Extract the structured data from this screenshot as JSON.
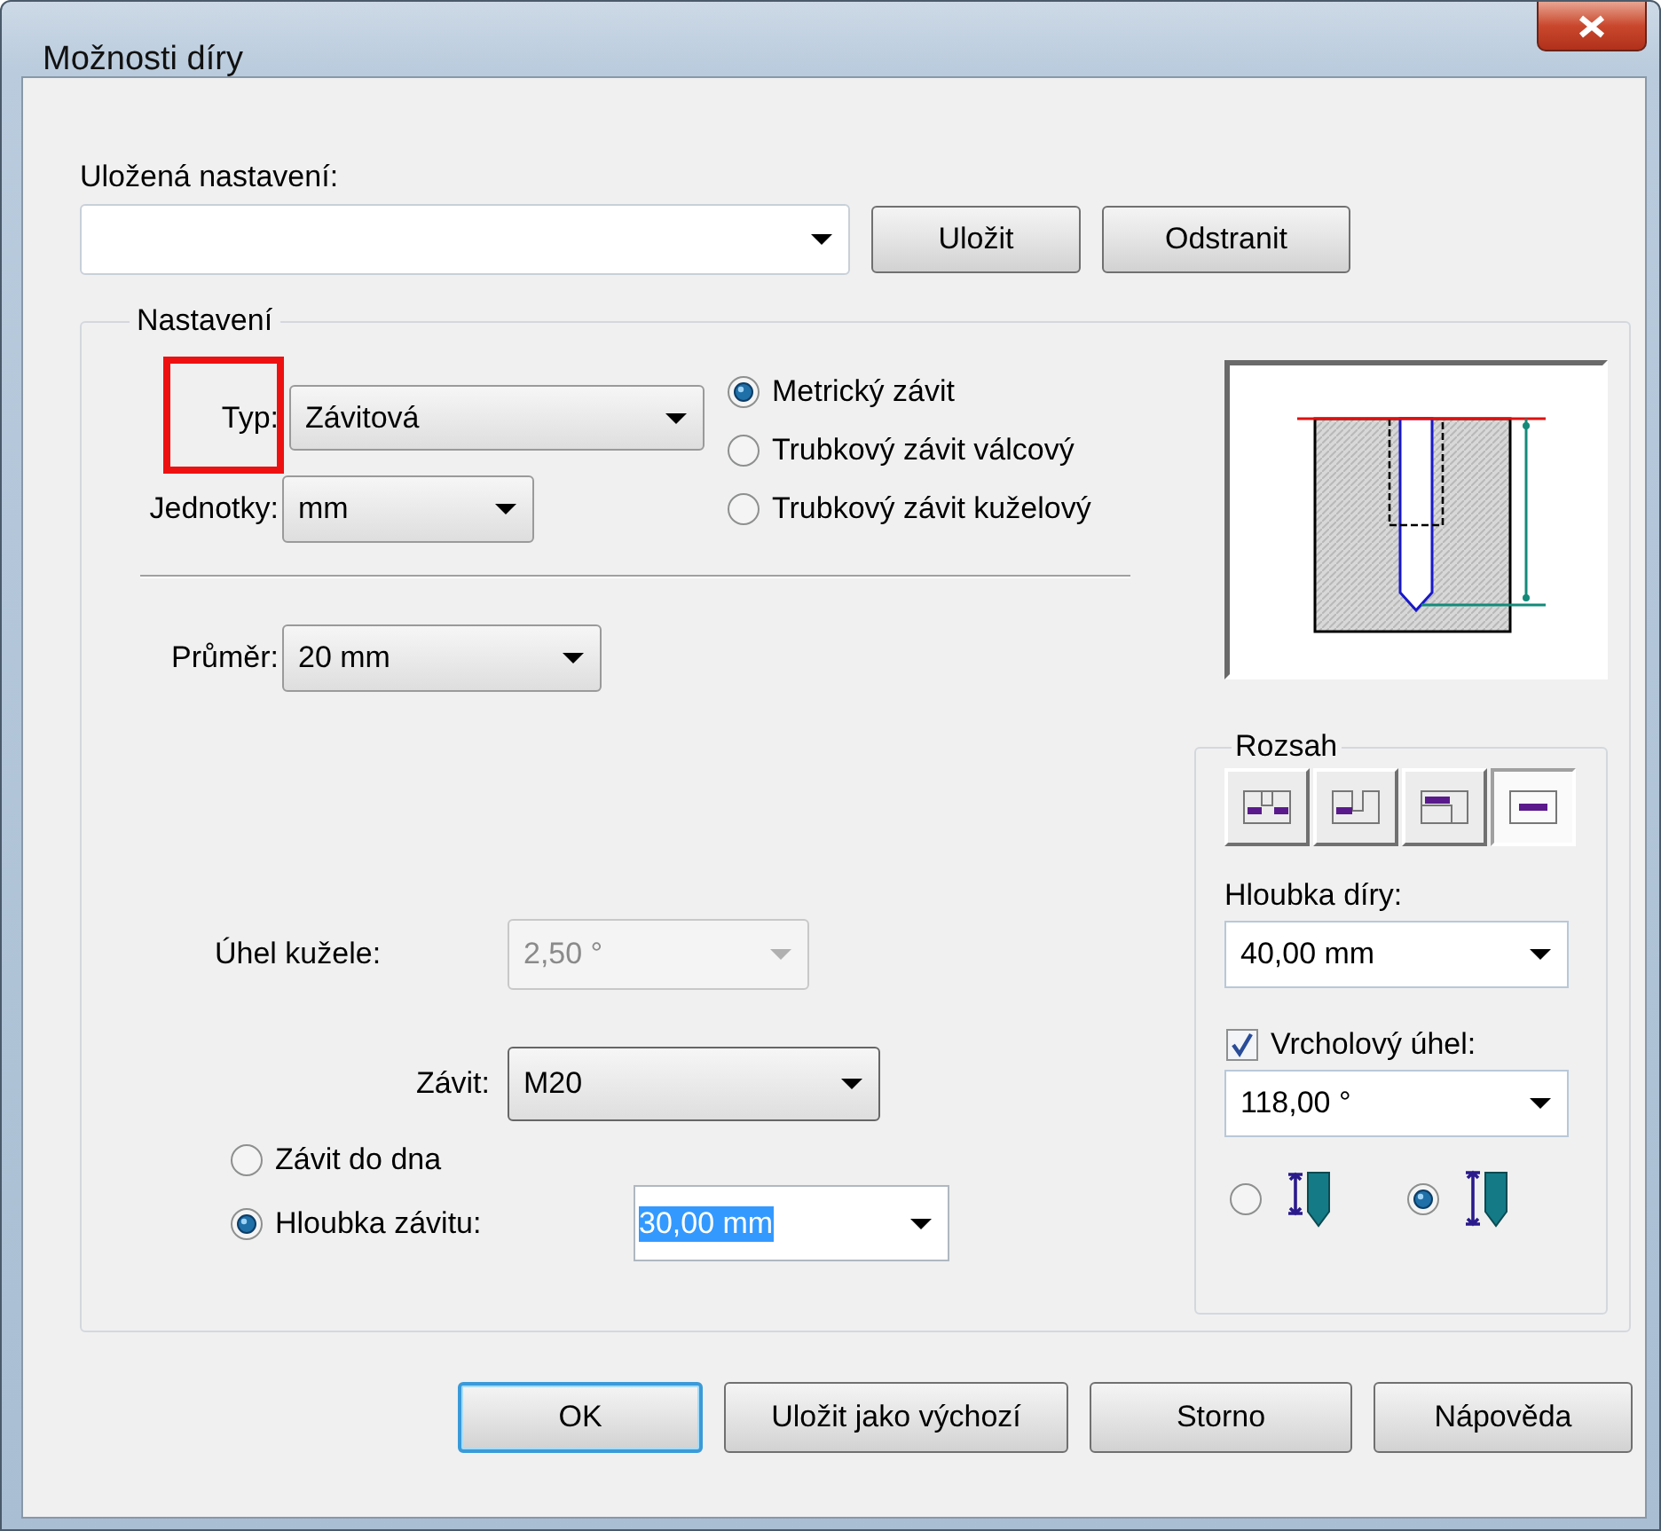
{
  "window": {
    "title": "Možnosti díry"
  },
  "saved_settings": {
    "label": "Uložená nastavení:",
    "buttons": [
      "Uložit",
      "Odstranit"
    ]
  },
  "settings": {
    "title": "Nastavení",
    "type": {
      "label": "Typ:",
      "value": "Závitová",
      "highlighted": true
    },
    "units": {
      "label": "Jednotky:",
      "value": "mm"
    },
    "thread_standards": [
      {
        "label": "Metrický závit",
        "selected": true
      },
      {
        "label": "Trubkový závit válcový",
        "selected": false
      },
      {
        "label": "Trubkový závit kuželový",
        "selected": false
      }
    ],
    "diameter": {
      "label": "Průměr:",
      "value": "20 mm"
    },
    "cone_angle": {
      "label": "Úhel kužele:",
      "value": "2,50 °",
      "disabled": true
    },
    "thread": {
      "label": "Závit:",
      "value": "M20"
    },
    "thread_extent": [
      {
        "label": "Závit do dna",
        "selected": false
      },
      {
        "label": "Hloubka závitu:",
        "selected": true
      }
    ],
    "thread_depth": {
      "value": "30,00 mm",
      "text_selected": true
    },
    "extent": {
      "title": "Rozsah",
      "options": [
        {
          "kind": "through",
          "selected": false
        },
        {
          "kind": "to-next",
          "selected": false
        },
        {
          "kind": "to-surface",
          "selected": false
        },
        {
          "kind": "distance",
          "selected": true
        }
      ],
      "hole_depth": {
        "label": "Hloubka díry:",
        "value": "40,00 mm"
      },
      "tip_angle": {
        "label": "Vrcholový úhel:",
        "checked": true,
        "value": "118,00 °"
      },
      "depth_reference": [
        {
          "kind": "to-shoulder",
          "selected": false
        },
        {
          "kind": "to-tip",
          "selected": true
        }
      ]
    }
  },
  "buttons": [
    {
      "label": "OK",
      "default": true
    },
    {
      "label": "Uložit jako výchozí",
      "default": false
    },
    {
      "label": "Storno",
      "default": false
    },
    {
      "label": "Nápověda",
      "default": false
    }
  ]
}
